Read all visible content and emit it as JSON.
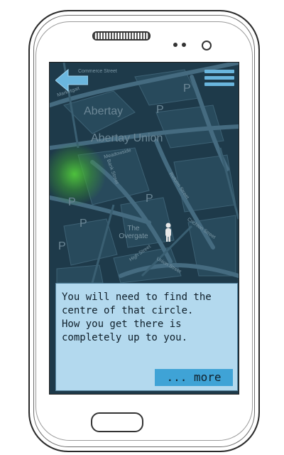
{
  "map": {
    "labels": {
      "street_top": "Commerce Street",
      "street_left": "Marketgait",
      "abertay": "Abertay",
      "union": "Abertay Union",
      "meadowside": "Meadowside",
      "reform": "Reform Street",
      "crichton": "Crichton Street",
      "overgate": "The Overgate",
      "high": "High Street",
      "union_st": "Union Street",
      "bank": "Bank Street",
      "parking": "P"
    }
  },
  "header": {
    "back_icon": "arrow-left-icon",
    "menu_icon": "hamburger-menu-icon"
  },
  "dialog": {
    "text": "You will need to find the\ncentre of that circle.\nHow you get there is\ncompletely up to you.",
    "more_label": "... more"
  },
  "colors": {
    "map_bg": "#1e3a4a",
    "dialog_bg": "#b3d9ee",
    "accent": "#3fa3d6",
    "glow": "#50c83c"
  }
}
